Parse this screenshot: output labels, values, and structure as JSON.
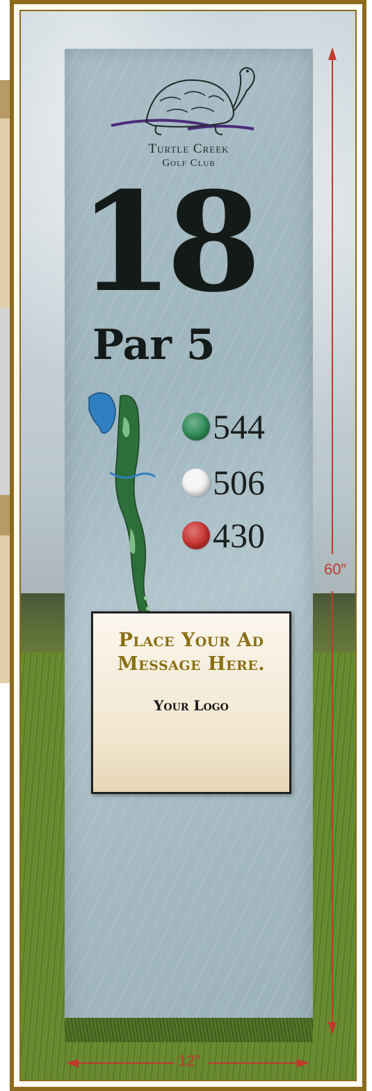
{
  "sign": {
    "club_line1": "Turtle Creek",
    "club_line2": "Golf Club",
    "hole_number": "18",
    "par": "Par 5",
    "tees": [
      {
        "color": "#2e8b57",
        "yards": "544"
      },
      {
        "color": "#f2f2f2",
        "yards": "506"
      },
      {
        "color": "#c8322f",
        "yards": "430"
      }
    ]
  },
  "ad": {
    "message": "Place Your Ad Message Here.",
    "logo": "Your Logo"
  },
  "dimensions": {
    "height": "60″",
    "width": "12″",
    "line_color": "#c0392b"
  },
  "colors": {
    "frame": "#8c6b1d",
    "ad_text": "#8a6f12"
  }
}
